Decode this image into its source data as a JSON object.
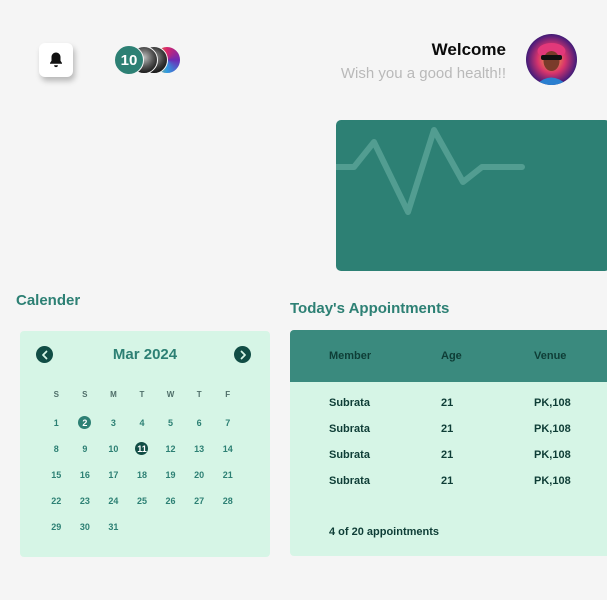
{
  "header": {
    "notifications_icon": "bell-icon",
    "users_count": "10",
    "welcome_title": "Welcome",
    "welcome_subtitle": "Wish you a good health!!"
  },
  "health_card": {
    "icon": "heartbeat-line"
  },
  "calendar": {
    "section_title": "Calender",
    "month_label": "Mar 2024",
    "weekdays": [
      "S",
      "S",
      "M",
      "T",
      "W",
      "T",
      "F"
    ],
    "days": [
      "1",
      "2",
      "3",
      "4",
      "5",
      "6",
      "7",
      "8",
      "9",
      "10",
      "11",
      "12",
      "13",
      "14",
      "15",
      "16",
      "17",
      "18",
      "19",
      "20",
      "21",
      "22",
      "23",
      "24",
      "25",
      "26",
      "27",
      "28",
      "29",
      "30",
      "31"
    ],
    "marked_day": "2",
    "selected_day": "11"
  },
  "appointments": {
    "section_title": "Today's Appointments",
    "columns": [
      "Member",
      "Age",
      "Venue"
    ],
    "rows": [
      {
        "member": "Subrata",
        "age": "21",
        "venue": "PK,108"
      },
      {
        "member": "Subrata",
        "age": "21",
        "venue": "PK,108"
      },
      {
        "member": "Subrata",
        "age": "21",
        "venue": "PK,108"
      },
      {
        "member": "Subrata",
        "age": "21",
        "venue": "PK,108"
      }
    ],
    "footer": "4 of 20 appointments"
  },
  "colors": {
    "accent": "#2d8074",
    "dark": "#114d45",
    "panel": "#d6f5e6",
    "background": "#f5f5f5"
  }
}
